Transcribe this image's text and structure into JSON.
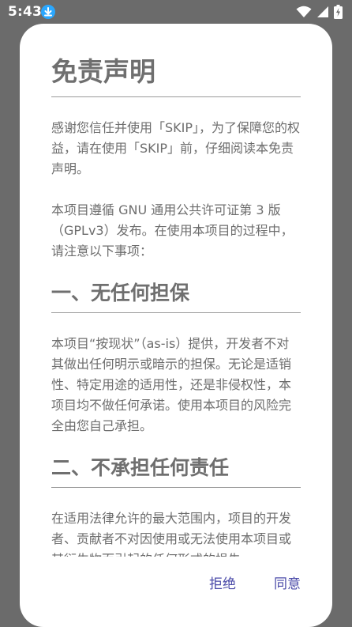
{
  "status_bar": {
    "time": "5:43",
    "icons": [
      "download-icon",
      "wifi-icon",
      "signal-icon",
      "battery-charging-icon"
    ]
  },
  "dialog": {
    "title": "免责声明",
    "intro_p1": "感谢您信任并使用「SKIP」，为了保障您的权益，请在使用「SKIP」前，仔细阅读本免责声明。",
    "intro_p2": "本项目遵循 GNU 通用公共许可证第 3 版（GPLv3）发布。在使用本项目的过程中，请注意以下事项：",
    "section1_title": "一、无任何担保",
    "section1_body": "本项目“按现状”（as-is）提供，开发者不对其做出任何明示或暗示的担保。无论是适销性、特定用途的适用性，还是非侵权性，本项目均不做任何承诺。使用本项目的风险完全由您自己承担。",
    "section2_title": "二、不承担任何责任",
    "section2_body": "在适用法律允许的最大范围内，项目的开发者、贡献者不对因使用或无法使用本项目或其衍生物而引起的任何形式的损失",
    "reject_label": "拒绝",
    "accept_label": "同意"
  },
  "colors": {
    "scrim": "#6b6b6b",
    "dialog_bg": "#ffffff",
    "text": "#6d6d6d",
    "accent": "#4a4aa8",
    "download_badge": "#2aa7ff"
  }
}
